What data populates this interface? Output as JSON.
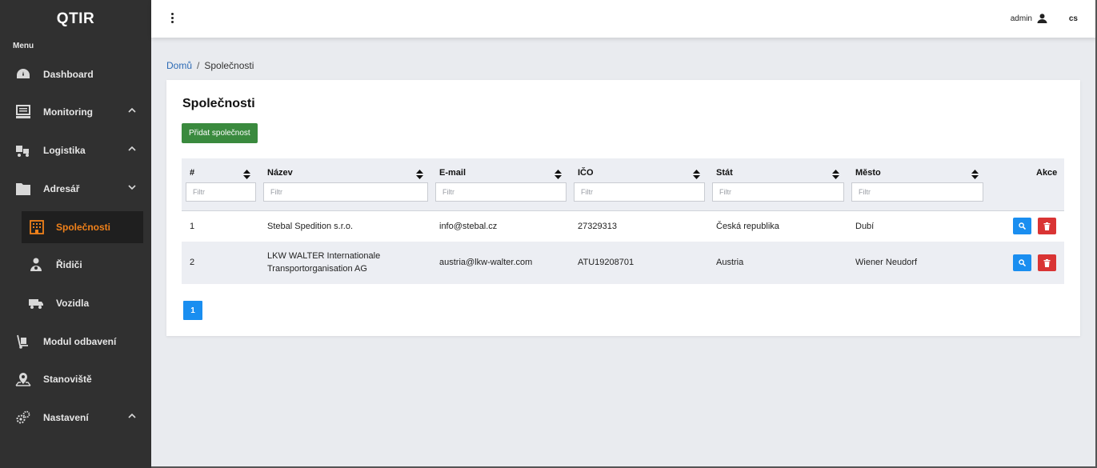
{
  "app": {
    "logo": "QTIR"
  },
  "sidebar": {
    "menu_label": "Menu",
    "items": [
      {
        "label": "Dashboard"
      },
      {
        "label": "Monitoring"
      },
      {
        "label": "Logistika"
      },
      {
        "label": "Adresář"
      },
      {
        "label": "Společnosti"
      },
      {
        "label": "Řidiči"
      },
      {
        "label": "Vozidla"
      },
      {
        "label": "Modul odbavení"
      },
      {
        "label": "Stanoviště"
      },
      {
        "label": "Nastavení"
      }
    ]
  },
  "topbar": {
    "user": "admin",
    "lang": "cs"
  },
  "breadcrumb": {
    "home": "Domů",
    "separator": "/",
    "current": "Společnosti"
  },
  "page": {
    "title": "Společnosti",
    "add_button": "Přidat společnost"
  },
  "table": {
    "columns": [
      "#",
      "Název",
      "E-mail",
      "IČO",
      "Stát",
      "Město",
      "Akce"
    ],
    "filter_placeholder": "Filtr",
    "rows": [
      {
        "id": "1",
        "name": "Stebal Spedition s.r.o.",
        "name_line2": "",
        "email": "info@stebal.cz",
        "ico": "27329313",
        "state": "Česká republika",
        "city": "Dubí"
      },
      {
        "id": "2",
        "name": "LKW WALTER Internationale",
        "name_line2": "Transportorganisation AG",
        "email": "austria@lkw-walter.com",
        "ico": "ATU19208701",
        "state": "Austria",
        "city": "Wiener Neudorf"
      }
    ]
  },
  "pagination": {
    "current": "1"
  },
  "colors": {
    "sidebar_bg": "#303030",
    "active_accent": "#f0811a",
    "success": "#3a8a3e",
    "primary": "#1a8ef0",
    "danger": "#d93434"
  }
}
